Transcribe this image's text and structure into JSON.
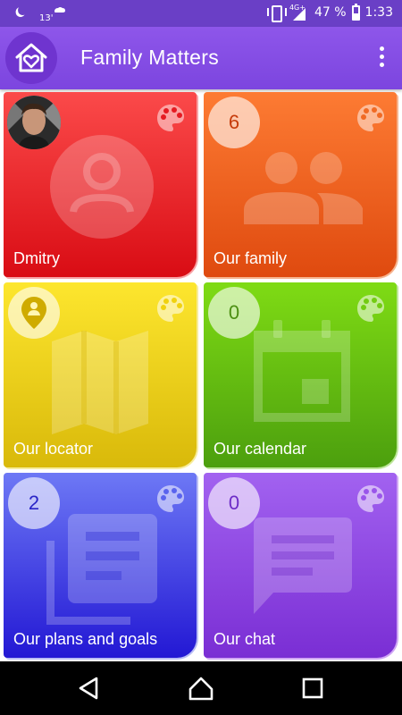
{
  "status_bar": {
    "temperature": "13'",
    "network": "4G+",
    "battery": "47 %",
    "time": "1:33"
  },
  "app_bar": {
    "title": "Family Matters"
  },
  "tiles": {
    "user": {
      "label": "Dmitry",
      "color": "#e8222b"
    },
    "family": {
      "label": "Our family",
      "count": "6",
      "color": "#ee5a1f"
    },
    "locator": {
      "label": "Our locator",
      "color": "#f2d81a"
    },
    "calendar": {
      "label": "Our calendar",
      "count": "0",
      "color": "#5ec21a"
    },
    "plans": {
      "label": "Our plans and goals",
      "count": "2",
      "color": "#3a3fdc"
    },
    "chat": {
      "label": "Our chat",
      "count": "0",
      "color": "#8a3ddf"
    }
  },
  "icons": [
    "home-heart-icon",
    "overflow-menu-icon",
    "palette-icon",
    "person-icon",
    "group-icon",
    "map-icon",
    "location-pin-icon",
    "calendar-icon",
    "news-icon",
    "chat-icon",
    "back-icon",
    "home-icon",
    "recents-icon"
  ]
}
